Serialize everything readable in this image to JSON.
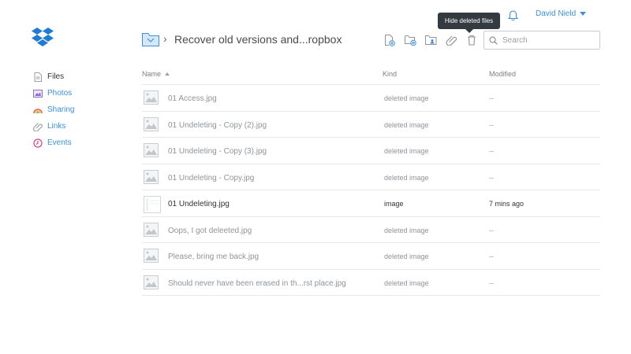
{
  "user": {
    "name": "David Nield"
  },
  "tooltip": {
    "text": "Hide deleted files"
  },
  "breadcrumb": {
    "title": "Recover old versions and...ropbox",
    "separator": "›"
  },
  "search": {
    "placeholder": "Search",
    "value": ""
  },
  "sidebar": {
    "items": [
      {
        "label": "Files",
        "icon": "files-icon",
        "active": true
      },
      {
        "label": "Photos",
        "icon": "photos-icon"
      },
      {
        "label": "Sharing",
        "icon": "sharing-icon"
      },
      {
        "label": "Links",
        "icon": "links-icon"
      },
      {
        "label": "Events",
        "icon": "events-icon"
      }
    ]
  },
  "toolbar": {
    "icons": [
      "upload-file-icon",
      "new-folder-icon",
      "shared-folder-icon",
      "share-link-icon",
      "deleted-files-icon"
    ]
  },
  "table": {
    "columns": {
      "name": "Name",
      "kind": "Kind",
      "modified": "Modified"
    },
    "rows": [
      {
        "name": "01 Access.jpg",
        "kind": "deleted image",
        "modified": "--"
      },
      {
        "name": "01 Undeleting - Copy (2).jpg",
        "kind": "deleted image",
        "modified": "--"
      },
      {
        "name": "01 Undeleting - Copy (3).jpg",
        "kind": "deleted image",
        "modified": "--"
      },
      {
        "name": "01 Undeleting - Copy.jpg",
        "kind": "deleted image",
        "modified": "--"
      },
      {
        "name": "01 Undeleting.jpg",
        "kind": "image",
        "modified": "7 mins ago"
      },
      {
        "name": "Oops, I got deleeted.jpg",
        "kind": "deleted image",
        "modified": "--"
      },
      {
        "name": "Please, bring me back.jpg",
        "kind": "deleted image",
        "modified": "--"
      },
      {
        "name": "Should never have been erased in th...rst place.jpg",
        "kind": "deleted image",
        "modified": "--"
      }
    ]
  },
  "colors": {
    "accent": "#3d8fdb",
    "logo": "#1f7cd6",
    "tooltip_bg": "#333a40"
  }
}
